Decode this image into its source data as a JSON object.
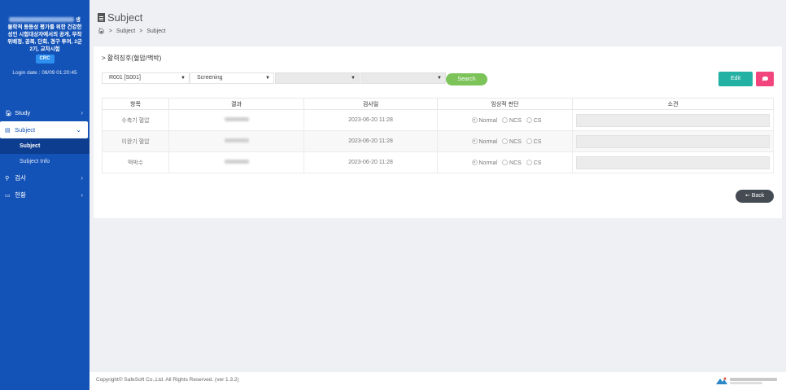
{
  "sidebar": {
    "study_title_suffix": "생",
    "study_title_lines": [
      "물학적 동등성 평가를 위한 건강한",
      "성인 시험대상자에서의 공개, 무작",
      "위배정, 공복, 단회, 경구 투여, 2군",
      "2기, 교차시험"
    ],
    "role_badge": "CRC",
    "login_date": "Login date : 08/09 01:20:45",
    "nav": [
      {
        "label": "Study",
        "icon": "home-icon"
      },
      {
        "label": "Subject",
        "icon": "document-icon"
      },
      {
        "label": "검사",
        "icon": "search-icon"
      },
      {
        "label": "현황",
        "icon": "monitor-icon"
      }
    ],
    "subnav": [
      "Subject",
      "Subject Info"
    ]
  },
  "header": {
    "title": "Subject",
    "breadcrumb": [
      "Subject",
      "Subject"
    ]
  },
  "section": {
    "title": "> 활력징후(혈압/맥박)"
  },
  "filters": {
    "subject": "R001 [S001]",
    "visit": "Screening",
    "select3": "",
    "select4": "",
    "search_label": "Search"
  },
  "buttons": {
    "edit": "Edit",
    "back": "Back"
  },
  "table": {
    "headers": [
      "항목",
      "결과",
      "검사일",
      "임상적 판단",
      "소견"
    ],
    "rows": [
      {
        "item": "수축기 혈압",
        "date": "2023-06-20 11:28"
      },
      {
        "item": "이완기 혈압",
        "date": "2023-06-20 11:28"
      },
      {
        "item": "맥박수",
        "date": "2023-06-20 11:28"
      }
    ],
    "judgement_options": [
      "Normal",
      "NCS",
      "CS"
    ]
  },
  "footer": {
    "copyright": "Copyright© SafeSoft Co.,Ltd. All Rights Reserved. (ver 1.3.2)"
  },
  "colors": {
    "sidebar": "#1352b7",
    "search": "#7cc359",
    "edit": "#22b1a2",
    "chat": "#f2457e",
    "back": "#444b52"
  }
}
